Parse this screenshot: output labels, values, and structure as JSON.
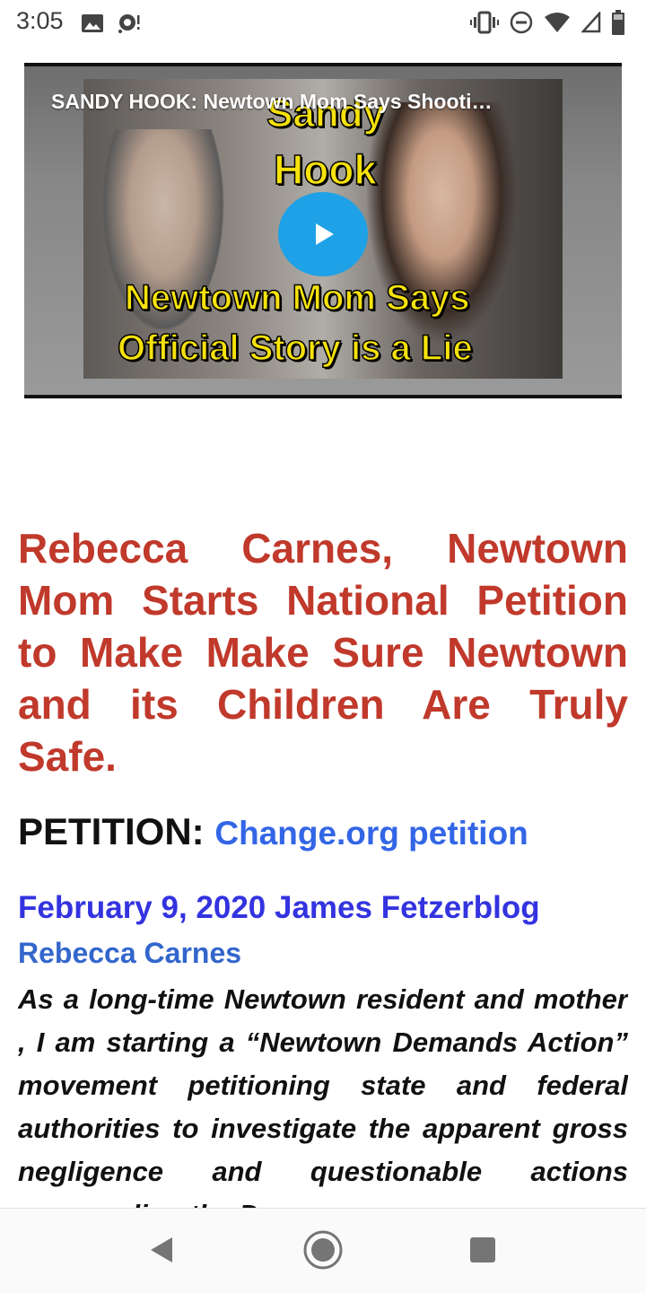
{
  "status_bar": {
    "time": "3:05"
  },
  "video": {
    "title": "SANDY HOOK: Newtown Mom Says Shooti…",
    "caption_line1": "Sandy",
    "caption_line2": "Hook",
    "caption_line3": "Newtown Mom Says",
    "caption_line4": "Official Story is a Lie"
  },
  "article": {
    "headline": "Rebecca Carnes, Newtown Mom Starts National Petition to Make Make Sure Newtown and its Children Are Truly Safe.",
    "petition_label": "PETITION:",
    "petition_link": "Change.org petition",
    "dateline": "February 9, 2020 James Fetzerblog",
    "author": "Rebecca Carnes",
    "body": "As a long-time Newtown resident and mother , I am starting a “Newtown Demands Action” movement petitioning state and federal authorities to investigate the apparent gross negligence and questionable actions surrounding the Dec"
  },
  "colors": {
    "headline": "#c0392b",
    "link": "#3366e6",
    "dateline": "#3333e0",
    "play_button": "#1ea1e6",
    "caption": "#f6e20c"
  }
}
